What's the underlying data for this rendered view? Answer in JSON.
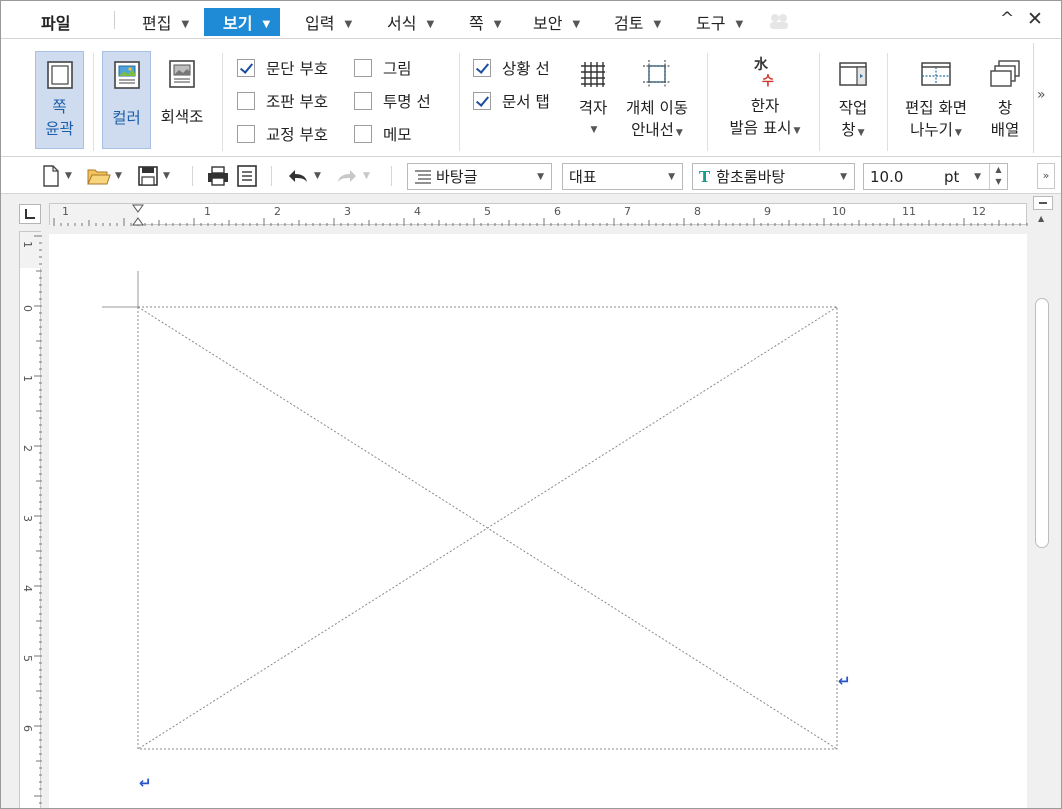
{
  "menu": {
    "file": "파일",
    "items": [
      {
        "label": "편집",
        "active": false
      },
      {
        "label": "보기",
        "active": true
      },
      {
        "label": "입력",
        "active": false
      },
      {
        "label": "서식",
        "active": false
      },
      {
        "label": "쪽",
        "active": false
      },
      {
        "label": "보안",
        "active": false
      },
      {
        "label": "검토",
        "active": false
      },
      {
        "label": "도구",
        "active": false
      }
    ],
    "collapse_icon": "^",
    "close_icon": "✕"
  },
  "ribbon": {
    "page_outline": {
      "line1": "쪽",
      "line2": "윤곽"
    },
    "color": "컬러",
    "grayscale": "회색조",
    "checks_col1": [
      {
        "label": "문단 부호",
        "checked": true
      },
      {
        "label": "조판 부호",
        "checked": false
      },
      {
        "label": "교정 부호",
        "checked": false
      }
    ],
    "checks_col2": [
      {
        "label": "그림",
        "checked": false
      },
      {
        "label": "투명 선",
        "checked": false
      },
      {
        "label": "메모",
        "checked": false
      }
    ],
    "checks_col3": [
      {
        "label": "상황 선",
        "checked": true
      },
      {
        "label": "문서 탭",
        "checked": true
      }
    ],
    "grid": "격자",
    "object_move": {
      "line1": "개체 이동",
      "line2": "안내선"
    },
    "hanja": {
      "line1": "한자",
      "line2": "발음 표시"
    },
    "task": {
      "line1": "작업",
      "line2": "창"
    },
    "split": {
      "line1": "편집 화면",
      "line2": "나누기"
    },
    "window": {
      "line1": "창",
      "line2": "배열"
    },
    "more": "»"
  },
  "toolbar": {
    "style": "바탕글",
    "lang": "대표",
    "font": "함초롬바탕",
    "size": "10.0",
    "unit": "pt",
    "more": "»"
  },
  "ruler": {
    "h_numbers": [
      "1",
      "1",
      "2",
      "3",
      "4",
      "5",
      "6",
      "7",
      "8",
      "9",
      "10",
      "11",
      "12"
    ],
    "v_numbers": [
      "1",
      "0",
      "1",
      "2",
      "3",
      "4",
      "5",
      "6"
    ]
  },
  "colors": {
    "accent": "#1f8ad6",
    "selected": "#cfdcf0",
    "para_mark": "#2a55c9"
  }
}
